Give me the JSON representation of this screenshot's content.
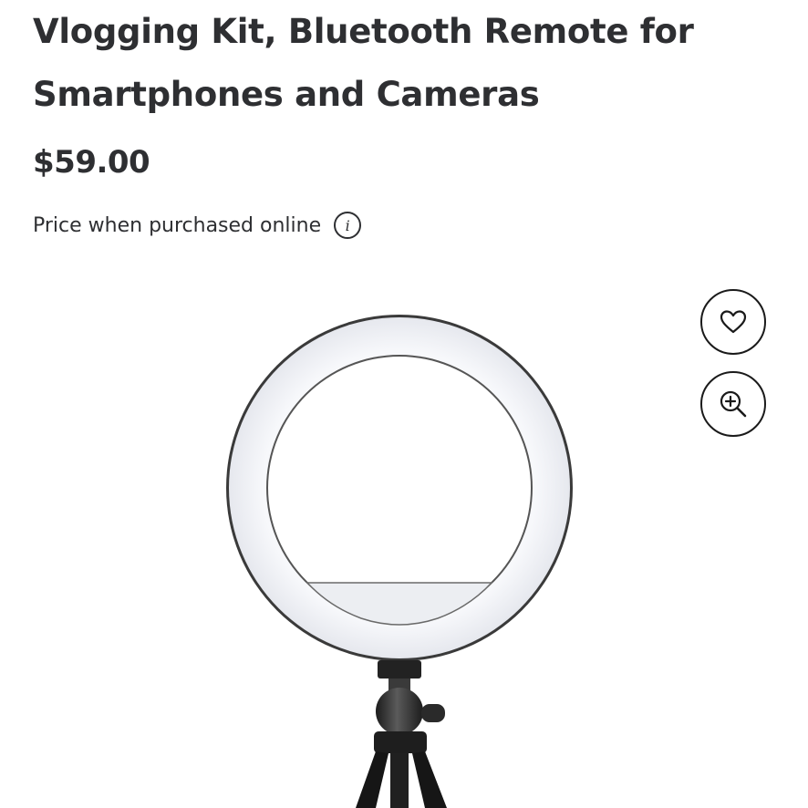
{
  "product": {
    "title_line1": "Vlogging Kit, Bluetooth Remote for",
    "title_line2": "Smartphones and Cameras",
    "price": "$59.00",
    "price_note": "Price when purchased online"
  },
  "icons": {
    "info": "info-icon",
    "favorite": "heart-icon",
    "zoom": "zoom-in-icon"
  },
  "image": {
    "subject": "ring-light-on-tripod"
  }
}
